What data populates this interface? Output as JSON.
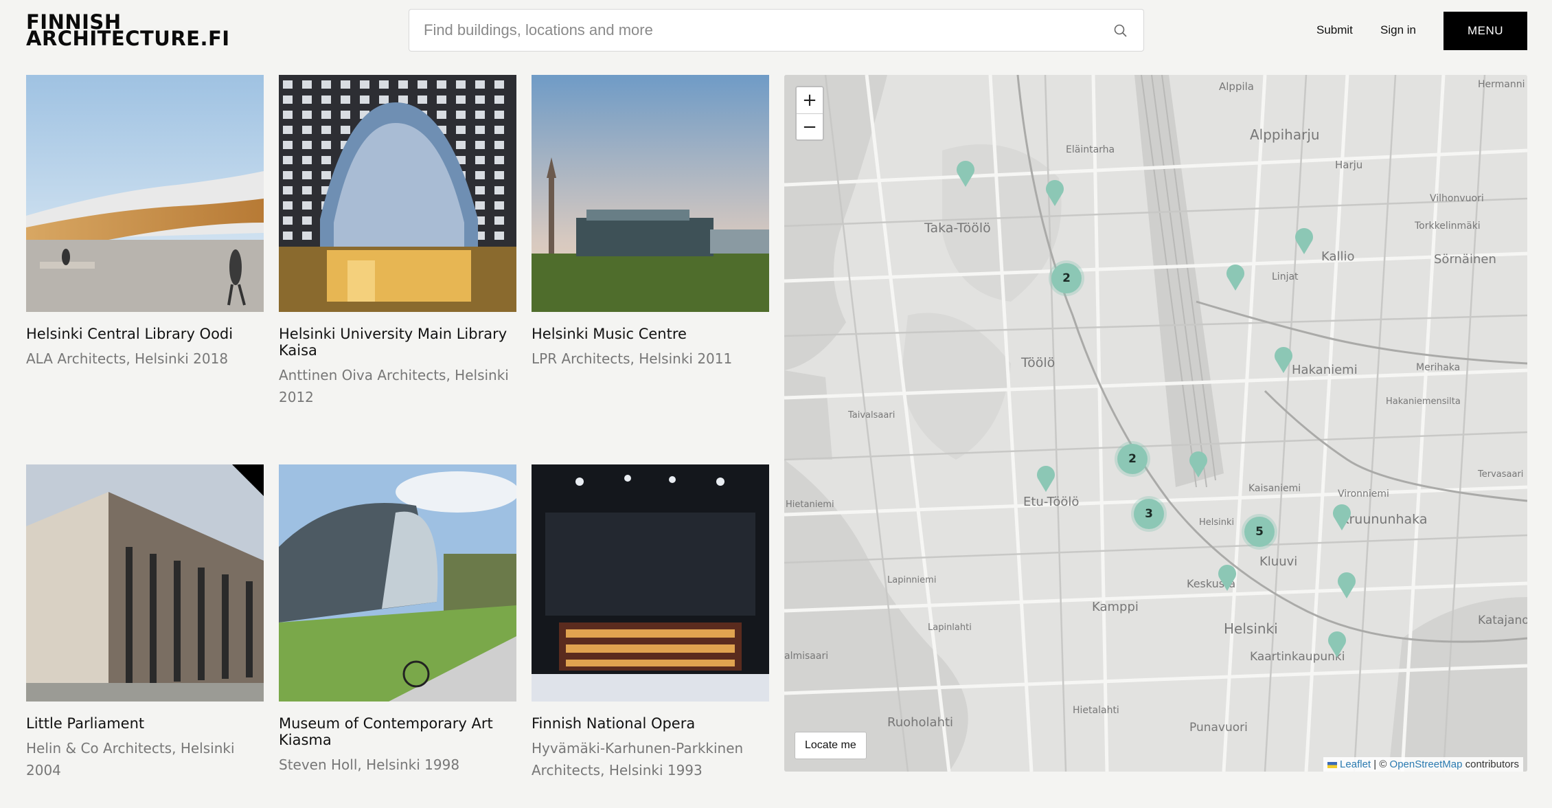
{
  "header": {
    "logo_line1": "FINNISH",
    "logo_line2": "ARCHITECTURE.FI",
    "search_placeholder": "Find buildings, locations and more",
    "submit_label": "Submit",
    "signin_label": "Sign in",
    "menu_label": "MENU"
  },
  "cards": [
    {
      "title": "Helsinki Central Library Oodi",
      "subtitle": "ALA Architects, Helsinki 2018"
    },
    {
      "title": "Helsinki University Main Library Kaisa",
      "subtitle": "Anttinen Oiva Architects, Helsinki 2012"
    },
    {
      "title": "Helsinki Music Centre",
      "subtitle": "LPR Architects, Helsinki 2011"
    },
    {
      "title": "Little Parliament",
      "subtitle": "Helin & Co Architects, Helsinki 2004"
    },
    {
      "title": "Museum of Contemporary Art Kiasma",
      "subtitle": "Steven Holl, Helsinki 1998"
    },
    {
      "title": "Finnish National Opera",
      "subtitle": "Hyvämäki-Karhunen-Parkkinen Architects, Helsinki 1993"
    }
  ],
  "map": {
    "zoom_in": "+",
    "zoom_out": "−",
    "locate_label": "Locate me",
    "attribution": {
      "leaflet": "Leaflet",
      "sep": " | © ",
      "osm": "OpenStreetMap",
      "suffix": " contributors"
    },
    "clusters": [
      "2",
      "2",
      "3",
      "5"
    ],
    "labels": {
      "alppila": "Alppila",
      "alppiharju": "Alppiharju",
      "hermanni": "Hermanni",
      "elaintarha": "Eläintarha",
      "harju": "Harju",
      "vilhonvuori": "Vilhonvuori",
      "taka_toolo": "Taka-Töölö",
      "torkkelinmaki": "Torkkelinmäki",
      "kallio": "Kallio",
      "sornainen": "Sörnäinen",
      "linjat": "Linjat",
      "toolo": "Töölö",
      "hakaniemi": "Hakaniemi",
      "merihaka": "Merihaka",
      "taivalsaari": "Taivalsaari",
      "hakaniemensilta": "Hakaniemensilta",
      "kaisaniemi": "Kaisaniemi",
      "tervasaari": "Tervasaari",
      "etu_toolo": "Etu-Töölö",
      "vironniemi": "Vironniemi",
      "kruununhaka": "Kruununhaka",
      "hietaniemi": "Hietaniemi",
      "kluuvi": "Kluuvi",
      "keskusta": "Keskusta",
      "lapinniemi": "Lapinniemi",
      "lapinlahti": "Lapinlahti",
      "kamppi": "Kamppi",
      "helsinki": "Helsinki",
      "katajanok": "Katajanok",
      "kaartinkaupunki": "Kaartinkaupunki",
      "ruoholahti": "Ruoholahti",
      "hietalahti": "Hietalahti",
      "punavuori": "Punavuori",
      "almisaari": "almisaari",
      "helsinki_st": "Helsinki"
    }
  }
}
